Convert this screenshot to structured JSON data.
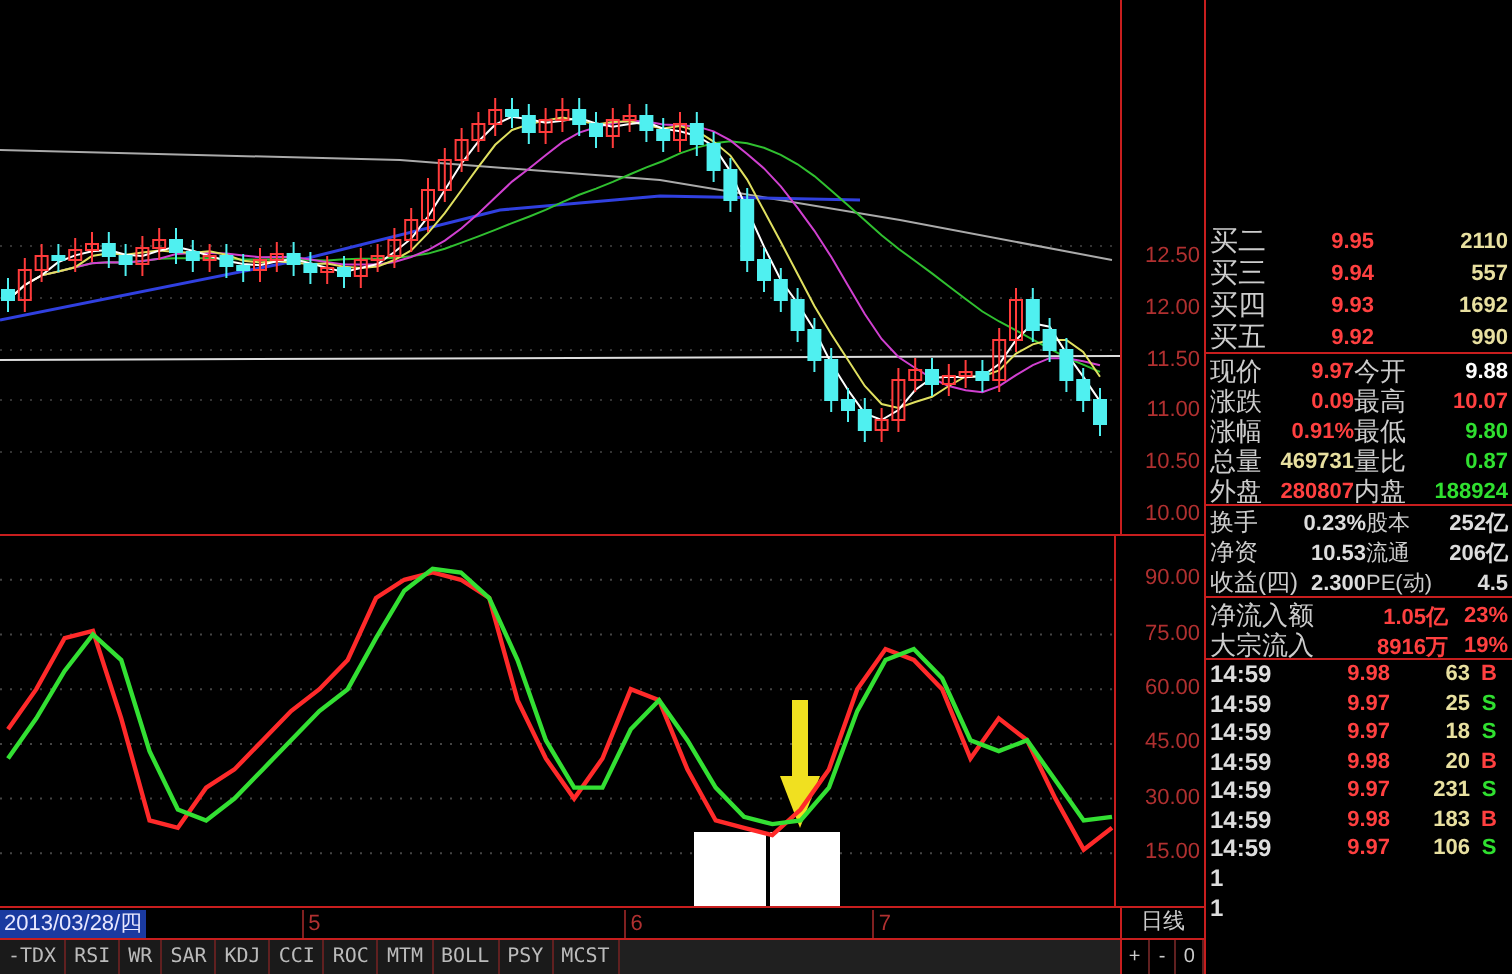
{
  "price_chart": {
    "axis_labels": [
      "12.50",
      "12.00",
      "11.50",
      "11.00",
      "10.50",
      "10.00"
    ]
  },
  "indicator_chart": {
    "chart_data": {
      "type": "line",
      "ylim": [
        0,
        102
      ],
      "grid": true,
      "yticks": [
        {
          "value": 90,
          "label": "90.00"
        },
        {
          "value": 75,
          "label": "75.00"
        },
        {
          "value": 60,
          "label": "60.00"
        },
        {
          "value": 45,
          "label": "45.00"
        },
        {
          "value": 30,
          "label": "30.00"
        },
        {
          "value": 15,
          "label": "15.00"
        }
      ],
      "series": [
        {
          "color": "#ff2a2a",
          "values": [
            49,
            60,
            74,
            76,
            52,
            24,
            22,
            33,
            38,
            46,
            54,
            60,
            68,
            85,
            90,
            92,
            90,
            85,
            57,
            41,
            30,
            41,
            60,
            57,
            38,
            24,
            22,
            20,
            27,
            38,
            60,
            71,
            68,
            60,
            41,
            52,
            46,
            30,
            16,
            22
          ]
        },
        {
          "color": "#33e033",
          "values": [
            41,
            52,
            65,
            75,
            68,
            43,
            27,
            24,
            30,
            38,
            46,
            54,
            60,
            74,
            87,
            93,
            92,
            85,
            68,
            46,
            33,
            33,
            49,
            57,
            46,
            33,
            25,
            23,
            24,
            33,
            54,
            68,
            71,
            63,
            46,
            43,
            46,
            35,
            24,
            25
          ]
        }
      ]
    }
  },
  "date_bar": {
    "current_date": "2013/03/28/四",
    "month_marks": [
      "5",
      "6",
      "7"
    ],
    "period": "日线"
  },
  "indicator_tabs": [
    "-TDX",
    "RSI",
    "WR",
    "SAR",
    "KDJ",
    "CCI",
    "ROC",
    "MTM",
    "BOLL",
    "PSY",
    "MCST"
  ],
  "zoom_buttons": [
    "+",
    "-",
    "0"
  ],
  "quote_panel": {
    "bids": [
      {
        "label": "买二",
        "price": "9.95",
        "volume": "2110"
      },
      {
        "label": "买三",
        "price": "9.94",
        "volume": "557"
      },
      {
        "label": "买四",
        "price": "9.93",
        "volume": "1692"
      },
      {
        "label": "买五",
        "price": "9.92",
        "volume": "990"
      }
    ],
    "quotes": [
      {
        "label": "现价",
        "value": {
          "text": "9.97",
          "color": "#ff4040"
        },
        "label_2": "今开",
        "value_2": {
          "text": "9.88",
          "color": "#ffffff"
        }
      },
      {
        "label": "涨跌",
        "value": {
          "text": "0.09",
          "color": "#ff4040"
        },
        "label_2": "最高",
        "value_2": {
          "text": "10.07",
          "color": "#ff4040"
        }
      },
      {
        "label": "涨幅",
        "value": {
          "text": "0.91%",
          "color": "#ff4040"
        },
        "label_2": "最低",
        "value_2": {
          "text": "9.80",
          "color": "#30e030"
        }
      },
      {
        "label": "总量",
        "value": {
          "text": "469731",
          "color": "#e8e0a0"
        },
        "label_2": "量比",
        "value_2": {
          "text": "0.87",
          "color": "#30e030"
        }
      },
      {
        "label": "外盘",
        "value": {
          "text": "280807",
          "color": "#ff4040"
        },
        "label_2": "内盘",
        "value_2": {
          "text": "188924",
          "color": "#30e030"
        }
      }
    ],
    "fundamentals": [
      {
        "label": "换手",
        "value": "0.23%",
        "label_2": "股本",
        "value_2": "252亿"
      },
      {
        "label": "净资",
        "value": "10.53",
        "label_2": "流通",
        "value_2": "206亿"
      },
      {
        "label": "收益(四)",
        "value": "2.300",
        "label_2": "PE(动)",
        "value_2": "4.5"
      }
    ],
    "flows": [
      {
        "label": "净流入额",
        "amount": "1.05亿",
        "share": "23%"
      },
      {
        "label": "大宗流入",
        "amount": "8916万",
        "share": "19%"
      }
    ],
    "trades": [
      {
        "time": "14:59",
        "price": "9.98",
        "volume": "63",
        "side": "B",
        "buy": true
      },
      {
        "time": "14:59",
        "price": "9.97",
        "volume": "25",
        "side": "S",
        "buy": false
      },
      {
        "time": "14:59",
        "price": "9.97",
        "volume": "18",
        "side": "S",
        "buy": false
      },
      {
        "time": "14:59",
        "price": "9.98",
        "volume": "20",
        "side": "B",
        "buy": true
      },
      {
        "time": "14:59",
        "price": "9.97",
        "volume": "231",
        "side": "S",
        "buy": false
      },
      {
        "time": "14:59",
        "price": "9.98",
        "volume": "183",
        "side": "B",
        "buy": true
      },
      {
        "time": "14:59",
        "price": "9.97",
        "volume": "106",
        "side": "S",
        "buy": false
      }
    ],
    "footer_marks": [
      "1",
      "1"
    ]
  }
}
